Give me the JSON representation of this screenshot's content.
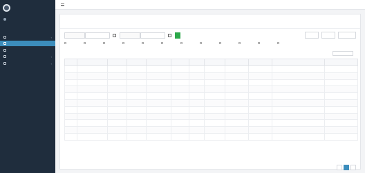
{
  "app": {
    "brand": "",
    "user_status": ""
  },
  "sidebar": {
    "section_label": "",
    "items": [
      {
        "label": "",
        "icon": "dashboard-icon",
        "active": false
      },
      {
        "label": "",
        "icon": "list-icon",
        "active": true
      },
      {
        "label": "",
        "icon": "file-icon",
        "active": false
      },
      {
        "label": "",
        "icon": "gear-icon",
        "active": false
      },
      {
        "label": "",
        "icon": "folder-icon",
        "active": false
      }
    ]
  },
  "topbar": {
    "right_text": ""
  },
  "page": {
    "title": "",
    "subtitle": ""
  },
  "filters": {
    "date_from_label": "",
    "date_from_value": "",
    "date_to_label": "",
    "date_to_value": "",
    "go_label": ""
  },
  "toolbar": {
    "buttons": [
      "",
      "",
      ""
    ]
  },
  "column_toggles": [
    "",
    "",
    "",
    "",
    "",
    "",
    "",
    "",
    "",
    "",
    "",
    ""
  ],
  "list": {
    "show_label": "",
    "info": ""
  },
  "table": {
    "headers": [
      "",
      "",
      "",
      "",
      "",
      "",
      "",
      "",
      "",
      "",
      "",
      ""
    ],
    "rows": [
      [
        "",
        "",
        "",
        "",
        "",
        "",
        "",
        "",
        "",
        "",
        "",
        ""
      ],
      [
        "",
        "",
        "",
        "",
        "",
        "",
        "",
        "",
        "",
        "",
        "",
        ""
      ],
      [
        "",
        "",
        "",
        "",
        "",
        "",
        "",
        "",
        "",
        "",
        "",
        ""
      ],
      [
        "",
        "",
        "",
        "",
        "",
        "",
        "",
        "",
        "",
        "",
        "",
        ""
      ],
      [
        "",
        "",
        "",
        "",
        "",
        "",
        "",
        "",
        "",
        "",
        "",
        ""
      ],
      [
        "",
        "",
        "",
        "",
        "",
        "",
        "",
        "",
        "",
        "",
        "",
        ""
      ],
      [
        "",
        "",
        "",
        "",
        "",
        "",
        "",
        "",
        "",
        "",
        "",
        ""
      ],
      [
        "",
        "",
        "",
        "",
        "",
        "",
        "",
        "",
        "",
        "",
        "",
        ""
      ],
      [
        "",
        "",
        "",
        "",
        "",
        "",
        "",
        "",
        "",
        "",
        "",
        ""
      ],
      [
        "",
        "",
        "",
        "",
        "",
        "",
        "",
        "",
        "",
        "",
        "",
        ""
      ],
      [
        "",
        "",
        "",
        "",
        "",
        "",
        "",
        "",
        "",
        "",
        "",
        ""
      ]
    ]
  },
  "pagination": {
    "prev": "",
    "current": "",
    "next": ""
  },
  "footer": {
    "text": ""
  },
  "colors": {
    "sidebar": "#1f2d3d",
    "accent": "#3c8dbc",
    "go_button": "#2ca84a"
  }
}
